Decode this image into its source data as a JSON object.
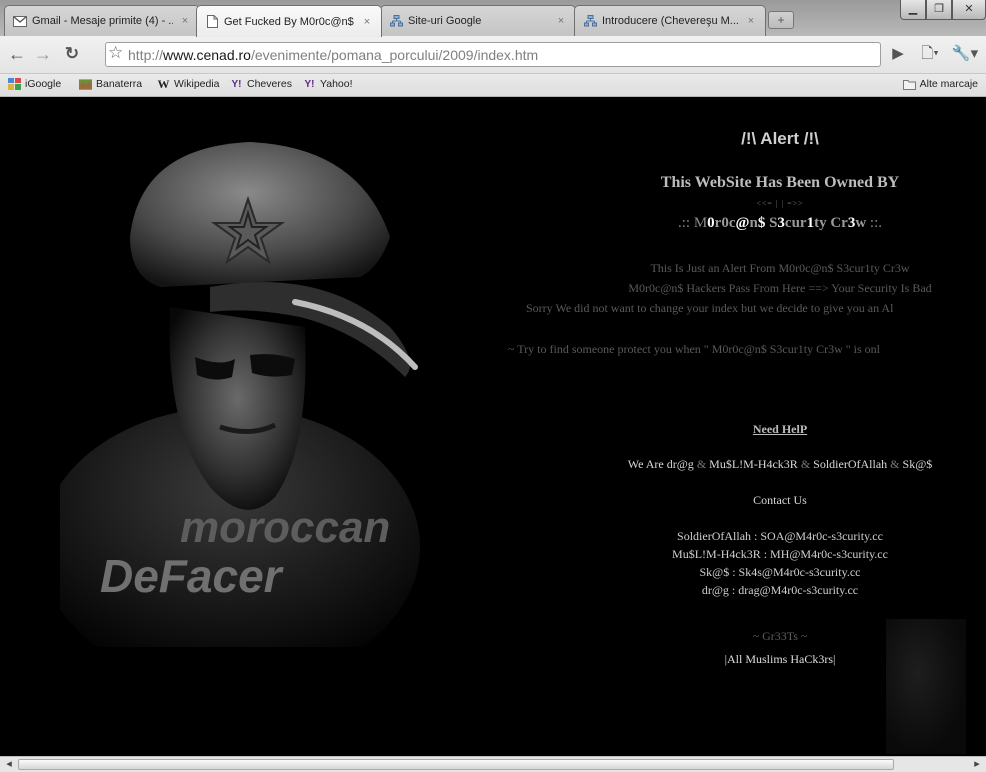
{
  "tabs": [
    {
      "icon": "gmail-icon",
      "title": "Gmail - Mesaje primite (4) - ...",
      "close": "×"
    },
    {
      "icon": "page-icon",
      "title": "Get Fucked By M0r0c@n$ ...",
      "close": "×"
    },
    {
      "icon": "sitemap-icon",
      "title": "Site-uri Google",
      "close": "×"
    },
    {
      "icon": "sitemap-icon",
      "title": "Introducere (Chevereşu M...",
      "close": "×"
    }
  ],
  "toolbar": {
    "url_prefix": "http://",
    "url_host": "www.cenad.ro",
    "url_path": "/evenimente/pomana_porcului/2009/index.htm"
  },
  "bookmarks": {
    "items": [
      "iGoogle",
      "Banaterra",
      "Wikipedia",
      "Cheveres",
      "Yahoo!"
    ],
    "other": "Alte marcaje"
  },
  "page": {
    "alert": "/!\\ Alert /!\\",
    "owned": "This WebSite Has Been Owned BY",
    "arrows": "<<= | | =>>",
    "crew_prefix": ".:: M",
    "crew_0": "0",
    "crew_r": "r",
    "crew_0c": "0c",
    "crew_at": "@",
    "crew_n": "n",
    "crew_dollar": "$",
    "crew_s": " S",
    "crew_3": "3",
    "crew_cur": "cur",
    "crew_1": "1",
    "crew_ty": "ty ",
    "crew_cr": "Cr",
    "crew_3b": "3",
    "crew_w": "w",
    "crew_suffix": " ::.",
    "msg1": "This Is Just an Alert From M0r0c@n$ S3cur1ty Cr3w",
    "msg2": "M0r0c@n$ Hackers Pass From Here ==> Your Security Is Bad",
    "msg3": "Sorry We did not want to change your index but we decide to give you an Al",
    "msg4": "~ Try to find someone protect you when \"  M0r0c@n$ S3cur1ty Cr3w \" is onl",
    "need_help": "Need HelP",
    "we_are": "We Are  dr@g",
    "amp": " & ",
    "member2": "Mu$L!M-H4ck3R",
    "member3": "SoldierOfAllah",
    "member4": "Sk@$",
    "contact": "Contact Us",
    "mails": [
      "SoldierOfAllah : SOA@M4r0c-s3curity.cc",
      "Mu$L!M-H4ck3R : MH@M4r0c-s3curity.cc",
      "Sk@$ : Sk4s@M4r0c-s3curity.cc",
      "dr@g : drag@M4r0c-s3curity.cc"
    ],
    "greets": "~ Gr33Ts ~",
    "muslims": "|All Muslims HaCk3rs|",
    "figure_caption_top": "moroccan",
    "figure_caption_bottom": "DeFacer"
  }
}
